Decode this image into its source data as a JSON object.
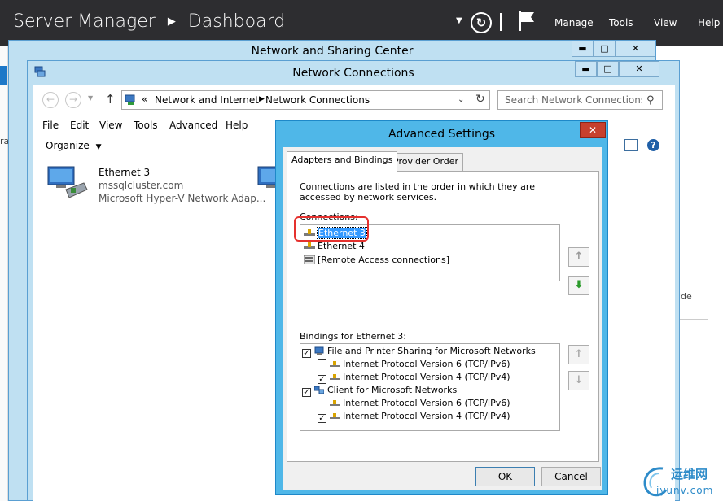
{
  "server_manager": {
    "title": "Server Manager",
    "breadcrumb_current": "Dashboard",
    "menu": {
      "manage": "Manage",
      "tools": "Tools",
      "view": "View",
      "help": "Help"
    },
    "left_fragment": "ra",
    "right_fragment": "ide"
  },
  "network_sharing_center": {
    "title": "Network and Sharing Center"
  },
  "network_connections": {
    "title": "Network Connections",
    "address": {
      "prefix": "«",
      "crumbs": [
        "Network and Internet",
        "Network Connections"
      ]
    },
    "search": {
      "placeholder": "Search Network Connections"
    },
    "menu": [
      "File",
      "Edit",
      "View",
      "Tools",
      "Advanced",
      "Help"
    ],
    "organize_label": "Organize",
    "adapters": [
      {
        "name": "Ethernet 3",
        "domain": "mssqlcluster.com",
        "description": "Microsoft Hyper-V Network Adap..."
      }
    ]
  },
  "advanced_settings": {
    "title": "Advanced Settings",
    "tabs": [
      "Adapters and Bindings",
      "Provider Order"
    ],
    "active_tab": "Adapters and Bindings",
    "description": "Connections are listed in the order in which they are accessed by network services.",
    "connections_label": "Connections:",
    "connections": [
      "Ethernet 3",
      "Ethernet 4",
      "[Remote Access connections]"
    ],
    "selected_connection": "Ethernet 3",
    "bindings_label": "Bindings for Ethernet 3:",
    "bindings": [
      {
        "label": "File and Printer Sharing for Microsoft Networks",
        "checked": true,
        "level": 0
      },
      {
        "label": "Internet Protocol Version 6 (TCP/IPv6)",
        "checked": false,
        "level": 1
      },
      {
        "label": "Internet Protocol Version 4 (TCP/IPv4)",
        "checked": true,
        "level": 1
      },
      {
        "label": "Client for Microsoft Networks",
        "checked": true,
        "level": 0
      },
      {
        "label": "Internet Protocol Version 6 (TCP/IPv6)",
        "checked": false,
        "level": 1
      },
      {
        "label": "Internet Protocol Version 4 (TCP/IPv4)",
        "checked": true,
        "level": 1
      }
    ],
    "ok_label": "OK",
    "cancel_label": "Cancel"
  },
  "watermark": {
    "zh": "运维网",
    "url": "iyunv.com"
  },
  "colors": {
    "server_manager_bar": "#2d2d30",
    "window_frame": "#bfe0f2",
    "dialog_frame": "#4fb7e8",
    "close_button": "#c7402d",
    "selection": "#3399ff",
    "annotation_red": "#e5312e"
  }
}
